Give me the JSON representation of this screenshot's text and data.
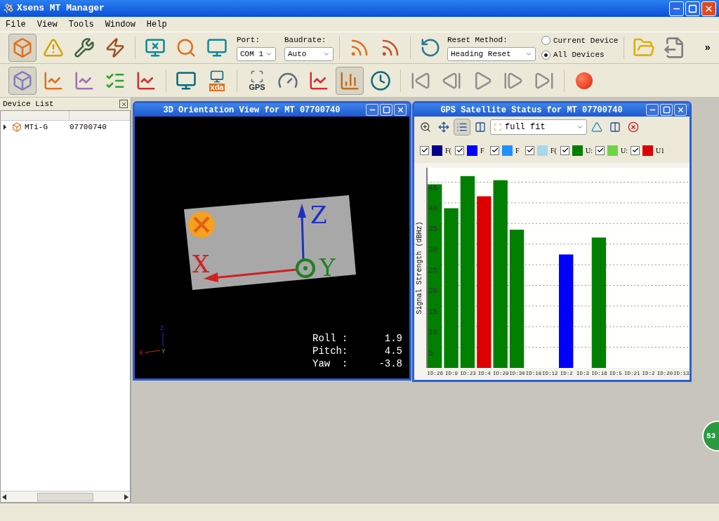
{
  "window": {
    "title": "Xsens MT Manager"
  },
  "menu": [
    "File",
    "View",
    "Tools",
    "Window",
    "Help"
  ],
  "toolbar_1": {
    "buttons": [
      {
        "kind": "device",
        "selected": true
      },
      {
        "kind": "warning-list",
        "selected": false
      },
      {
        "kind": "wrench-list",
        "selected": false
      },
      {
        "kind": "bolt-list",
        "selected": false
      },
      {
        "kind": "disconnect",
        "selected": false
      },
      {
        "kind": "scan",
        "selected": false
      },
      {
        "kind": "inspect",
        "selected": false
      }
    ],
    "port": {
      "label": "Port:",
      "value": "COM 1"
    },
    "baudrate": {
      "label": "Baudrate:",
      "value": "Auto"
    },
    "tools": [
      {
        "kind": "feed-wrench",
        "selected": false
      },
      {
        "kind": "feed-x",
        "selected": false
      },
      {
        "kind": "reset",
        "selected": false
      }
    ],
    "reset_method": {
      "label": "Reset Method:",
      "value": "Heading Reset"
    },
    "scope": [
      {
        "label": "Current Device",
        "selected": false
      },
      {
        "label": "All Devices",
        "selected": true
      }
    ],
    "file_buttons": [
      {
        "kind": "open",
        "selected": false
      },
      {
        "kind": "export",
        "selected": false
      }
    ],
    "overflow": "»"
  },
  "toolbar_2": {
    "buttons": [
      {
        "kind": "cube",
        "selected": true
      },
      {
        "kind": "graph-device",
        "selected": false
      },
      {
        "kind": "graph-cube",
        "selected": false
      },
      {
        "kind": "graph-check",
        "selected": false
      },
      {
        "kind": "graph-scale",
        "selected": false
      },
      {
        "kind": "faff-device",
        "selected": false
      },
      {
        "kind": "faff-file",
        "label": "xda",
        "selected": false
      },
      {
        "kind": "gps-grid",
        "label": "GPS",
        "selected": false
      },
      {
        "kind": "graph-gauge",
        "selected": false
      },
      {
        "kind": "graph-scale",
        "selected": false
      },
      {
        "kind": "satellite-chart",
        "selected": true
      },
      {
        "kind": "clock",
        "selected": false
      },
      {
        "kind": "first",
        "selected": false
      },
      {
        "kind": "prev",
        "selected": false
      },
      {
        "kind": "play",
        "selected": false
      },
      {
        "kind": "next",
        "selected": false
      },
      {
        "kind": "last",
        "selected": false
      },
      {
        "kind": "record",
        "selected": false
      }
    ]
  },
  "device_list": {
    "title": "Device List",
    "rows": [
      {
        "name": "MTi-G",
        "id": "07700740",
        "expanded": false
      }
    ]
  },
  "orientation_window": {
    "title": "3D Orientation View for MT 07700740",
    "axis_labels": [
      "X",
      "Y",
      "Z"
    ],
    "triad_labels": [
      "X",
      "Y",
      "Z"
    ],
    "readouts": [
      {
        "label": "Roll :",
        "value": "1.9"
      },
      {
        "label": "Pitch:",
        "value": "4.5"
      },
      {
        "label": "Yaw  :",
        "value": "-3.8"
      }
    ]
  },
  "gps_window": {
    "title": "GPS Satellite Status for MT 07700740",
    "toolbar": [
      {
        "kind": "zoom",
        "selected": false
      },
      {
        "kind": "move",
        "selected": false
      },
      {
        "kind": "legend",
        "selected": true
      },
      {
        "kind": "columns",
        "selected": false
      }
    ],
    "fit": "full fit",
    "tools": [
      {
        "kind": "ruler"
      },
      {
        "kind": "fit-width"
      },
      {
        "kind": "delete"
      }
    ],
    "legend": [
      {
        "checked": true
      },
      {
        "checked": true
      },
      {
        "checked": true
      },
      {
        "checked": true
      },
      {
        "checked": true
      },
      {
        "checked": true
      },
      {
        "checked": true
      }
    ],
    "chart_data": {
      "type": "bar",
      "ylabel": "Signal Strength (dBHz)",
      "ylim": [
        0,
        48.5
      ],
      "yticks": [
        5,
        10,
        15,
        20,
        25,
        30,
        35,
        40,
        45
      ],
      "stacked": true,
      "grid": true,
      "categories": [
        "ID:26",
        "ID:9",
        "ID:23",
        "ID:4",
        "ID:29",
        "ID:30",
        "ID:18",
        "ID:12",
        "ID:2",
        "ID:3",
        "ID:16",
        "ID:5",
        "ID:21",
        "ID:2",
        "ID:20",
        "ID:13"
      ],
      "series": [
        {
          "name": "F(",
          "color": "#00008b",
          "values": [
            null,
            null,
            null,
            null,
            null,
            null,
            null,
            null,
            null,
            null,
            null,
            null,
            null,
            null,
            null,
            null
          ]
        },
        {
          "name": "F",
          "color": "#0000ff",
          "values": [
            null,
            null,
            null,
            null,
            null,
            null,
            null,
            null,
            27.5,
            null,
            null,
            null,
            null,
            null,
            null,
            null
          ]
        },
        {
          "name": "F",
          "color": "#1e90ff",
          "values": [
            null,
            null,
            null,
            null,
            null,
            null,
            null,
            null,
            null,
            null,
            null,
            null,
            null,
            null,
            null,
            null
          ]
        },
        {
          "name": "F(",
          "color": "#a6d8ee",
          "values": [
            null,
            null,
            null,
            null,
            null,
            null,
            null,
            null,
            null,
            null,
            null,
            null,
            null,
            null,
            null,
            null
          ]
        },
        {
          "name": "U:",
          "color": "#007f00",
          "values": [
            44.5,
            38.7,
            46.5,
            null,
            45.5,
            33.5,
            null,
            null,
            null,
            null,
            31.6,
            null,
            null,
            null,
            null,
            null
          ]
        },
        {
          "name": "U:",
          "color": "#6fd34a",
          "values": [
            null,
            null,
            null,
            null,
            null,
            null,
            null,
            null,
            null,
            null,
            null,
            null,
            null,
            null,
            null,
            null
          ]
        },
        {
          "name": "U1",
          "color": "#dd0000",
          "values": [
            null,
            null,
            null,
            41.6,
            null,
            null,
            null,
            null,
            null,
            null,
            null,
            null,
            null,
            null,
            null,
            null
          ]
        }
      ]
    }
  },
  "badge": "53"
}
